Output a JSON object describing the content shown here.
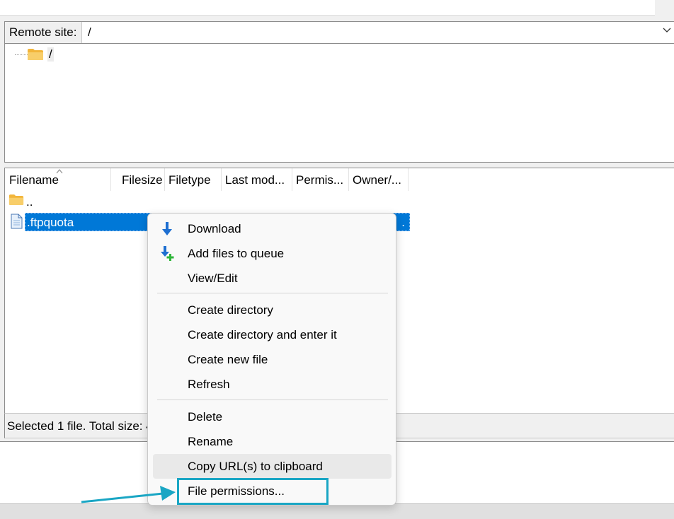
{
  "remote_site": {
    "label": "Remote site:",
    "path": "/"
  },
  "tree": {
    "root_label": "/"
  },
  "file_list": {
    "columns": [
      {
        "label": "Filename"
      },
      {
        "label": "Filesize"
      },
      {
        "label": "Filetype"
      },
      {
        "label": "Last mod..."
      },
      {
        "label": "Permis..."
      },
      {
        "label": "Owner/..."
      }
    ],
    "rows": [
      {
        "name": ".."
      },
      {
        "name": ".ftpquota",
        "trailing": "."
      }
    ]
  },
  "status_bar": {
    "text": "Selected 1 file. Total size: 4"
  },
  "context_menu": {
    "items": [
      {
        "label": "Download",
        "icon": "download-arrow-icon"
      },
      {
        "label": "Add files to queue",
        "icon": "add-to-queue-icon"
      },
      {
        "label": "View/Edit"
      },
      {
        "label": "Create directory"
      },
      {
        "label": "Create directory and enter it"
      },
      {
        "label": "Create new file"
      },
      {
        "label": "Refresh"
      },
      {
        "label": "Delete"
      },
      {
        "label": "Rename"
      },
      {
        "label": "Copy URL(s) to clipboard"
      },
      {
        "label": "File permissions..."
      }
    ]
  },
  "colors": {
    "selection": "#0078d7",
    "callout_highlight": "#1aa6c4",
    "download_icon": "#1e6fd1",
    "add_icon_plus": "#2fb53a"
  }
}
